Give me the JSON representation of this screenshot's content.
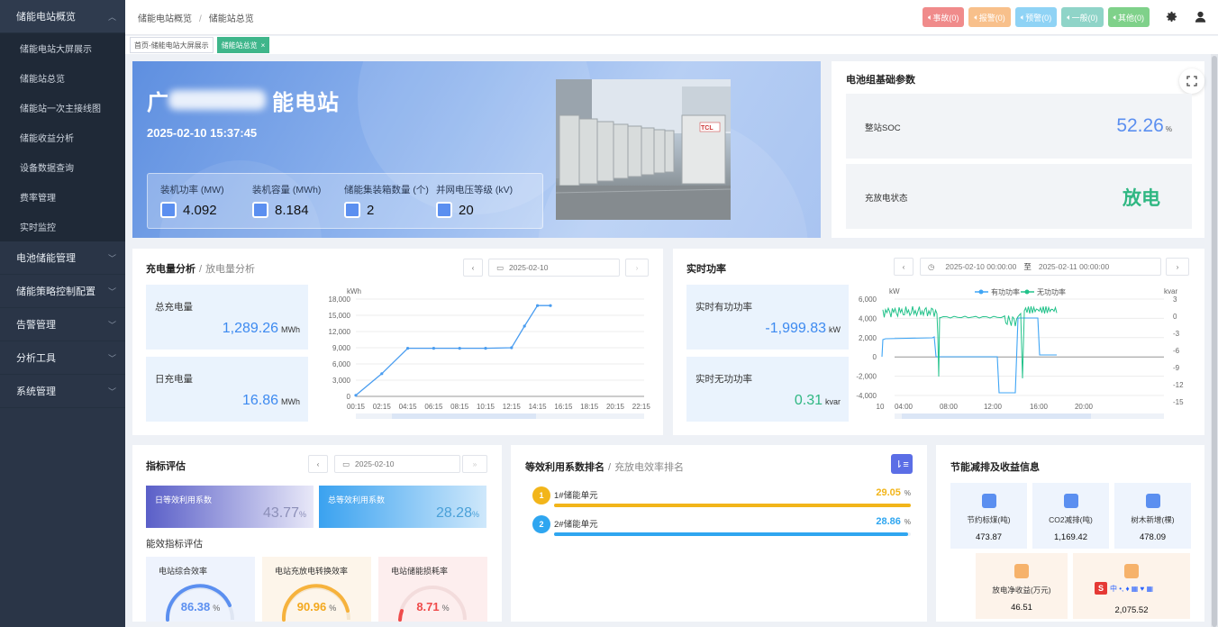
{
  "sidebar": {
    "groups": [
      {
        "label": "储能电站概览",
        "open": true,
        "items": [
          "储能电站大屏展示",
          "储能站总览",
          "储能站一次主接线图",
          "储能收益分析",
          "设备数据查询",
          "费率管理",
          "实时监控"
        ]
      },
      {
        "label": "电池储能管理"
      },
      {
        "label": "储能策略控制配置"
      },
      {
        "label": "告警管理"
      },
      {
        "label": "分析工具"
      },
      {
        "label": "系统管理"
      }
    ]
  },
  "breadcrumb": [
    "储能电站概览",
    "储能站总览"
  ],
  "alarms": [
    {
      "label": "事故(0)",
      "color": "#f08b8b"
    },
    {
      "label": "报警(0)",
      "color": "#f8c08b"
    },
    {
      "label": "预警(0)",
      "color": "#8fd3f5"
    },
    {
      "label": "一般(0)",
      "color": "#8fd4c8"
    },
    {
      "label": "其他(0)",
      "color": "#7fd18a"
    }
  ],
  "tabs": [
    {
      "label": "首页-储能电站大屏展示"
    },
    {
      "label": "储能站总览",
      "active": true
    }
  ],
  "hero": {
    "title_prefix": "广",
    "title_suffix": "能电站",
    "datetime": "2025-02-10 15:37:45",
    "stats": [
      {
        "label": "装机功率 (MW)",
        "value": "4.092"
      },
      {
        "label": "装机容量 (MWh)",
        "value": "8.184"
      },
      {
        "label": "储能集装箱数量 (个)",
        "value": "2"
      },
      {
        "label": "并网电压等级 (kV)",
        "value": "20"
      }
    ],
    "photo_label": "TCL"
  },
  "battery": {
    "title": "电池组基础参数",
    "soc_label": "整站SOC",
    "soc_value": "52.26",
    "soc_unit": "%",
    "state_label": "充放电状态",
    "state_value": "放电"
  },
  "charge": {
    "title": "充电量分析",
    "alt_title": "放电量分析",
    "date": "2025-02-10",
    "total_label": "总充电量",
    "total_value": "1,289.26",
    "total_unit": "MWh",
    "daily_label": "日充电量",
    "daily_value": "16.86",
    "daily_unit": "MWh"
  },
  "realtime": {
    "title": "实时功率",
    "start": "2025-02-10 00:00:00",
    "to": "至",
    "end": "2025-02-11 00:00:00",
    "active_label": "实时有功功率",
    "active_value": "-1,999.83",
    "active_unit": "kW",
    "reactive_label": "实时无功功率",
    "reactive_value": "0.31",
    "reactive_unit": "kvar"
  },
  "indicator": {
    "title": "指标评估",
    "date": "2025-02-10",
    "daily_label": "日等效利用系数",
    "daily_value": "43.77",
    "total_label": "总等效利用系数",
    "total_value": "28.28",
    "pct": "%",
    "section_label": "能效指标评估",
    "gauges": [
      {
        "label": "电站综合效率",
        "value": "86.38",
        "color": "#5b8ff0",
        "bg": "#eef3fd"
      },
      {
        "label": "电站充放电转换效率",
        "value": "90.96",
        "color": "#f6b23c",
        "bg": "#fdf5ea"
      },
      {
        "label": "电站储能损耗率",
        "value": "8.71",
        "color": "#ef4b4b",
        "bg": "#fdeeee"
      }
    ]
  },
  "rank": {
    "title": "等效利用系数排名",
    "alt_title": "充放电效率排名",
    "items": [
      {
        "rank": "1",
        "name": "1#储能单元",
        "value": "29.05",
        "pct": "%",
        "fraction": 1.0,
        "color": "#f2b51a"
      },
      {
        "rank": "2",
        "name": "2#储能单元",
        "value": "28.86",
        "pct": "%",
        "fraction": 0.993,
        "color": "#2fa6f0"
      }
    ]
  },
  "saving": {
    "title": "节能减排及收益信息",
    "items": [
      {
        "label": "节约标煤(吨)",
        "value": "473.87"
      },
      {
        "label": "CO2减排(吨)",
        "value": "1,169.42"
      },
      {
        "label": "树木新增(棵)",
        "value": "478.09"
      },
      {
        "label": "放电净收益(万元)",
        "value": "46.51"
      },
      {
        "label": "",
        "value": "2,075.52"
      }
    ]
  },
  "chart_data": [
    {
      "type": "line",
      "ylabel": "kWh",
      "ylim": [
        0,
        18000
      ],
      "yticks": [
        "18,000",
        "15,000",
        "12,000",
        "9,000",
        "6,000",
        "3,000",
        "0"
      ],
      "categories": [
        "00:15",
        "02:15",
        "04:15",
        "06:15",
        "08:15",
        "10:15",
        "12:15",
        "14:15",
        "16:15",
        "18:15",
        "20:15",
        "22:15"
      ],
      "x": [
        "00:15",
        "02:15",
        "04:15",
        "06:15",
        "08:15",
        "10:15",
        "12:15",
        "13:15",
        "14:15",
        "15:15"
      ],
      "series": [
        {
          "values": [
            200,
            4200,
            8900,
            8900,
            8900,
            8900,
            9000,
            13000,
            16800,
            16800
          ]
        }
      ]
    },
    {
      "type": "line",
      "ylabel": "kW",
      "y2label": "kvar",
      "ylim": [
        -2000,
        6000
      ],
      "y2lim": [
        -15,
        3
      ],
      "yticks": [
        "6,000",
        "4,000",
        "2,000",
        "0",
        "-2,000",
        "-4,000"
      ],
      "y2ticks": [
        "3",
        "0",
        "-3",
        "-6",
        "-9",
        "-12",
        "-15"
      ],
      "xticks": [
        "10",
        "04:00",
        "08:00",
        "12:00",
        "16:00",
        "20:00"
      ],
      "legend": [
        "有功功率",
        "无功功率"
      ]
    }
  ]
}
